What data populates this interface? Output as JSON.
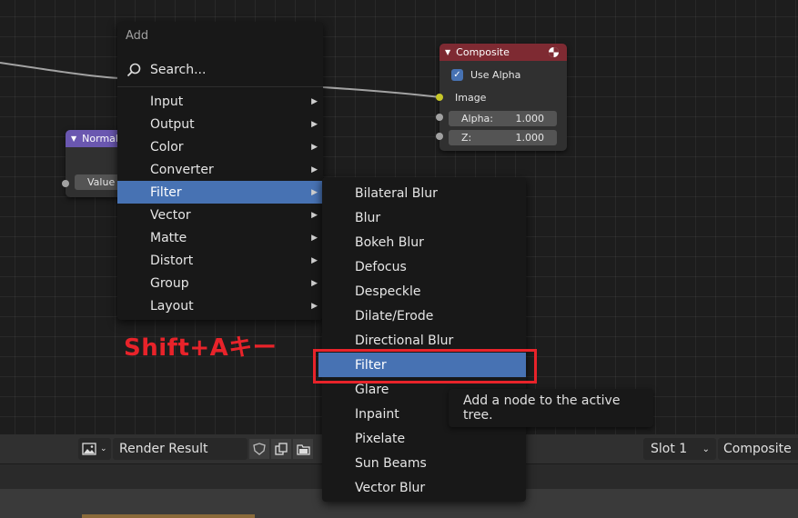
{
  "add_menu": {
    "title": "Add",
    "search_label": "Search...",
    "items": [
      {
        "label": "Input",
        "key": "I"
      },
      {
        "label": "Output",
        "key": "O"
      },
      {
        "label": "Color",
        "key": "C"
      },
      {
        "label": "Converter",
        "key": "v"
      },
      {
        "label": "Filter",
        "key": "F"
      },
      {
        "label": "Vector",
        "key": "V"
      },
      {
        "label": "Matte",
        "key": "M"
      },
      {
        "label": "Distort",
        "key": "D"
      },
      {
        "label": "Group",
        "key": "G"
      },
      {
        "label": "Layout",
        "key": "L"
      }
    ]
  },
  "filter_submenu": {
    "items": [
      "Bilateral Blur",
      "Blur",
      "Bokeh Blur",
      "Defocus",
      "Despeckle",
      "Dilate/Erode",
      "Directional Blur",
      "Filter",
      "Glare",
      "Inpaint",
      "Pixelate",
      "Sun Beams",
      "Vector Blur"
    ]
  },
  "composite_node": {
    "title": "Composite",
    "use_alpha_label": "Use Alpha",
    "image_label": "Image",
    "alpha_label": "Alpha:",
    "alpha_value": "1.000",
    "z_label": "Z:",
    "z_value": "1.000"
  },
  "normal_node": {
    "title": "Normal",
    "value_label": "Value"
  },
  "annotation": {
    "text": "Shift+Aキー",
    "color": "#e8232a"
  },
  "tooltip": {
    "text": "Add a node to the active tree."
  },
  "image_editor_bar": {
    "image_name": "Render Result",
    "slot_label": "Slot 1",
    "layer_label": "Composite"
  },
  "colors": {
    "accent": "#4772b3",
    "composite_header": "#7e2a32",
    "normal_header": "#6a57b0",
    "highlight_box": "#e8232a"
  }
}
